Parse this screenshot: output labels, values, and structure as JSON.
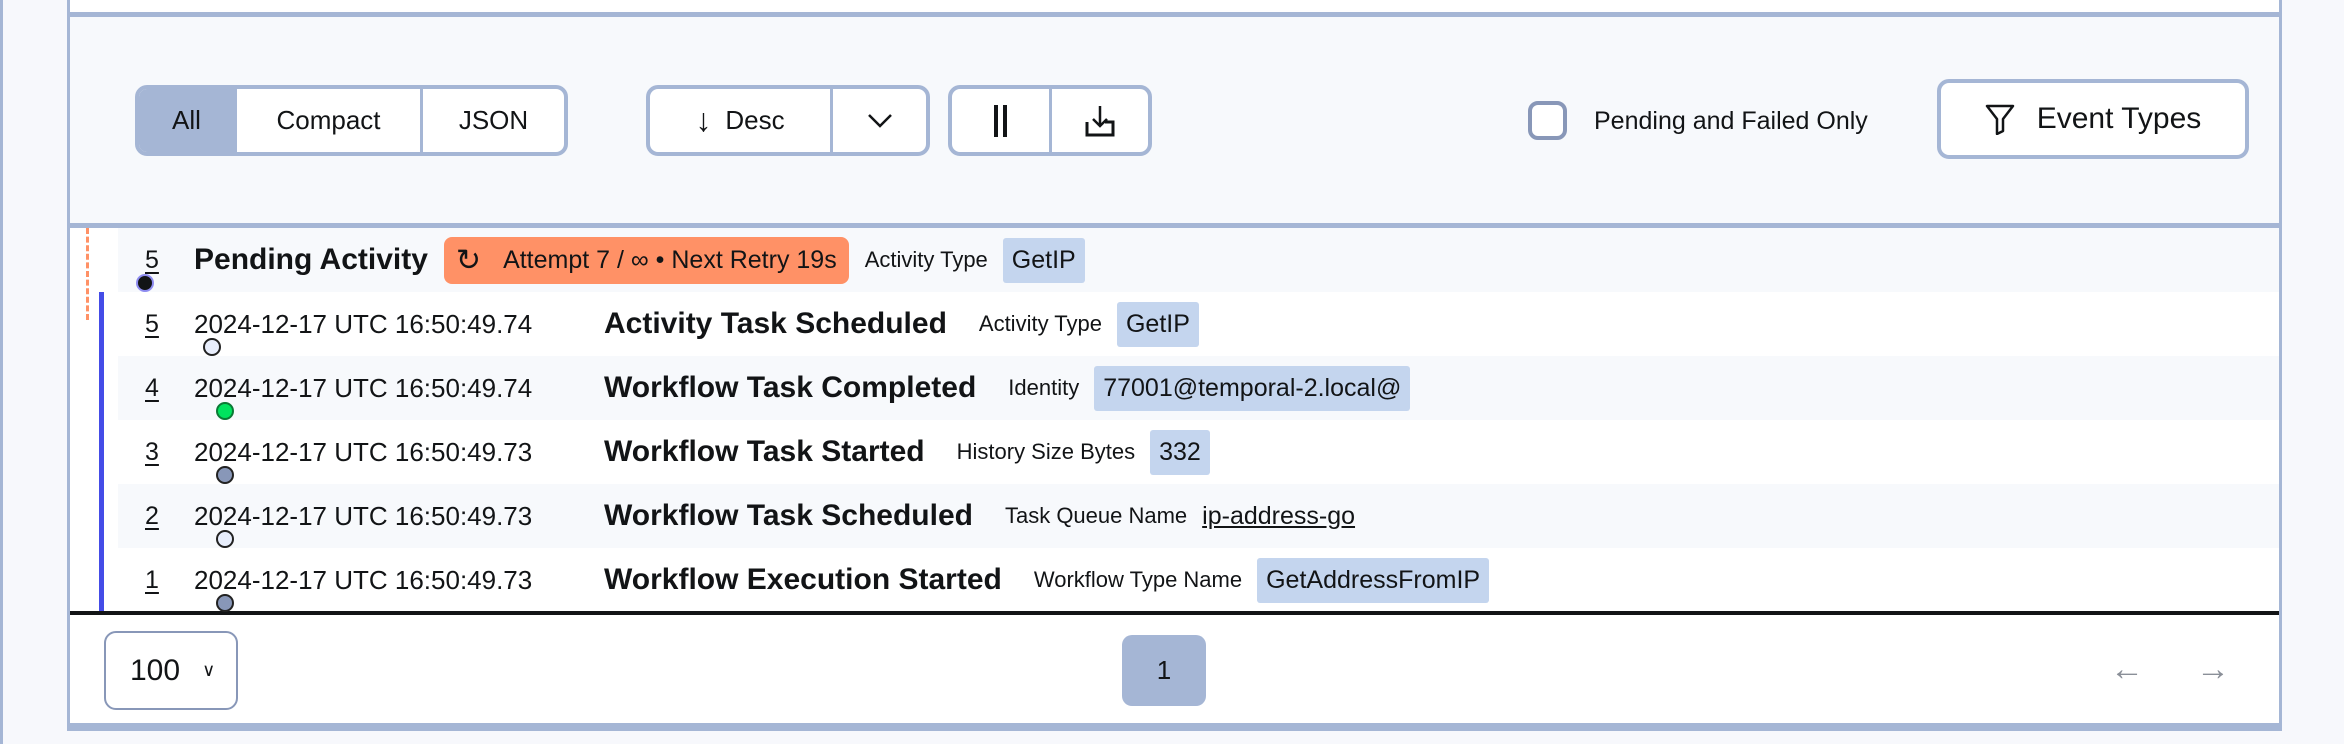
{
  "toolbar": {
    "view_modes": [
      {
        "label": "All",
        "active": true
      },
      {
        "label": "Compact",
        "active": false
      },
      {
        "label": "JSON",
        "active": false
      }
    ],
    "sort": {
      "label": "Desc",
      "icon": "arrow-down-icon",
      "dropdown_icon": "chevron-down-icon"
    },
    "pause_icon": "pause-icon",
    "download_icon": "download-icon",
    "pending_failed_only": {
      "label": "Pending and Failed Only",
      "checked": false
    },
    "event_types": {
      "label": "Event Types",
      "icon": "filter-icon"
    }
  },
  "pending": {
    "id": "5",
    "title": "Pending Activity",
    "badge": "Attempt 7 / ∞ • Next Retry 19s",
    "label": "Activity Type",
    "value": "GetIP"
  },
  "events": [
    {
      "id": "5",
      "timestamp": "2024-12-17 UTC 16:50:49.74",
      "title": "Activity Task Scheduled",
      "label": "Activity Type",
      "value": "GetIP",
      "status": "scheduled"
    },
    {
      "id": "4",
      "timestamp": "2024-12-17 UTC 16:50:49.74",
      "title": "Workflow Task Completed",
      "label": "Identity",
      "value": "77001@temporal-2.local@",
      "status": "completed"
    },
    {
      "id": "3",
      "timestamp": "2024-12-17 UTC 16:50:49.73",
      "title": "Workflow Task Started",
      "label": "History Size Bytes",
      "value": "332",
      "status": "started"
    },
    {
      "id": "2",
      "timestamp": "2024-12-17 UTC 16:50:49.73",
      "title": "Workflow Task Scheduled",
      "label": "Task Queue Name",
      "value": "ip-address-go",
      "status": "scheduled"
    },
    {
      "id": "1",
      "timestamp": "2024-12-17 UTC 16:50:49.73",
      "title": "Workflow Execution Started",
      "label": "Workflow Type Name",
      "value": "GetAddressFromIP",
      "status": "started"
    }
  ],
  "footer": {
    "page_size": "100",
    "current_page": "1"
  },
  "colors": {
    "border": "#a5b6d5",
    "pending": "#ff9166",
    "timeline": "#444ce7",
    "completed": "#00e35e",
    "value_bg": "#c4d5ee"
  }
}
